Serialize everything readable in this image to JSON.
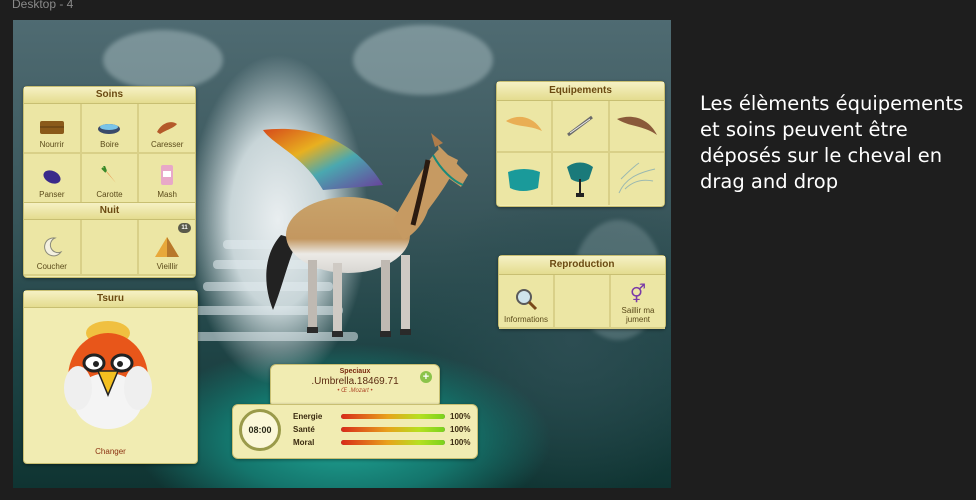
{
  "frame": {
    "label": "Desktop - 4"
  },
  "annotation": {
    "text": "Les élèments équipements et soins peuvent être déposés sur le cheval en drag and drop"
  },
  "soins": {
    "title": "Soins",
    "items": [
      {
        "label": "Nourrir",
        "icon": "hay-bale-icon"
      },
      {
        "label": "Boire",
        "icon": "water-bowl-icon"
      },
      {
        "label": "Caresser",
        "icon": "caress-hand-icon"
      },
      {
        "label": "Panser",
        "icon": "brush-icon"
      },
      {
        "label": "Carotte",
        "icon": "carrot-icon"
      },
      {
        "label": "Mash",
        "icon": "mash-bag-icon"
      }
    ]
  },
  "nuit": {
    "title": "Nuit",
    "items": [
      {
        "label": "Coucher",
        "icon": "moon-icon"
      },
      {
        "label": "",
        "icon": ""
      },
      {
        "label": "Vieillir",
        "icon": "pyramid-icon",
        "badge": "11"
      }
    ]
  },
  "companion": {
    "title": "Tsuru",
    "change_label": "Changer"
  },
  "equipements": {
    "title": "Equipements",
    "items": [
      {
        "icon": "wings-orange-icon"
      },
      {
        "icon": "flute-icon"
      },
      {
        "icon": "wings-brown-icon"
      },
      {
        "icon": "saddle-pad-icon"
      },
      {
        "icon": "saddle-icon"
      },
      {
        "icon": "wings-outline-icon"
      }
    ]
  },
  "reproduction": {
    "title": "Reproduction",
    "items": [
      {
        "label": "Informations",
        "icon": "magnifier-icon"
      },
      {
        "label": "",
        "icon": ""
      },
      {
        "label": "Saillir ma jument",
        "icon": "gender-icon"
      }
    ]
  },
  "horse_info": {
    "category": "Speciaux",
    "name": ".Umbrella.18469.71",
    "affix": "• Œ .Mozart •",
    "time": "08:00",
    "stats": [
      {
        "label": "Energie",
        "value": "100%",
        "fraction": 1.0
      },
      {
        "label": "Santé",
        "value": "100%",
        "fraction": 1.0
      },
      {
        "label": "Moral",
        "value": "100%",
        "fraction": 1.0
      }
    ]
  },
  "colors": {
    "panel_bg": "#f1ecb2",
    "title_text": "#6b4a12",
    "accent_green": "#8bc34a"
  }
}
